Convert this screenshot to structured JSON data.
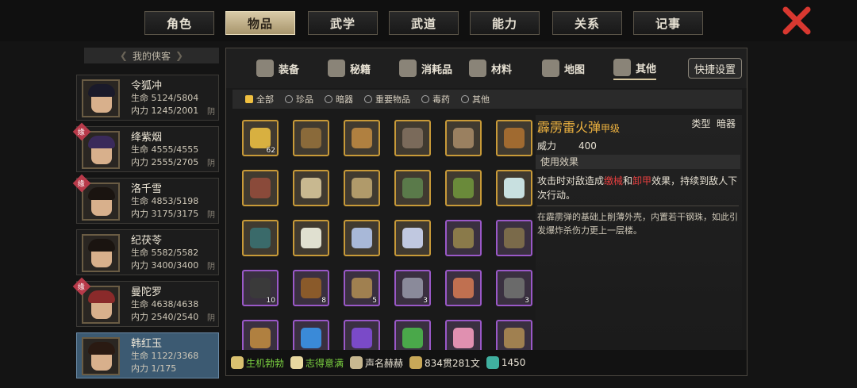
{
  "tabs": [
    "角色",
    "物品",
    "武学",
    "武道",
    "能力",
    "关系",
    "记事"
  ],
  "active_tab": 1,
  "roster": {
    "header": "我的侠客",
    "heroes": [
      {
        "name": "令狐冲",
        "hp_label": "生命",
        "hp": "5124/5804",
        "mp_label": "内力",
        "mp": "1245/2001",
        "suffix": "阴",
        "marked": false,
        "selected": false
      },
      {
        "name": "绛紫烟",
        "hp_label": "生命",
        "hp": "4555/4555",
        "mp_label": "内力",
        "mp": "2555/2705",
        "suffix": "阴",
        "marked": true,
        "selected": false
      },
      {
        "name": "洛千雪",
        "hp_label": "生命",
        "hp": "4853/5198",
        "mp_label": "内力",
        "mp": "3175/3175",
        "suffix": "阴",
        "marked": true,
        "selected": false
      },
      {
        "name": "纪茯苓",
        "hp_label": "生命",
        "hp": "5582/5582",
        "mp_label": "内力",
        "mp": "3400/3400",
        "suffix": "阴",
        "marked": false,
        "selected": false
      },
      {
        "name": "曼陀罗",
        "hp_label": "生命",
        "hp": "4638/4638",
        "mp_label": "内力",
        "mp": "2540/2540",
        "suffix": "阴",
        "marked": true,
        "selected": false
      },
      {
        "name": "韩红玉",
        "hp_label": "生命",
        "hp": "1122/3368",
        "mp_label": "内力",
        "mp": "1/175",
        "suffix": "",
        "marked": false,
        "selected": true
      }
    ],
    "mark_text": "缘"
  },
  "categories": [
    {
      "label": "装备",
      "icon": "equipment-icon"
    },
    {
      "label": "秘籍",
      "icon": "manual-icon"
    },
    {
      "label": "消耗品",
      "icon": "potion-icon"
    },
    {
      "label": "材料",
      "icon": "herb-icon"
    },
    {
      "label": "地图",
      "icon": "map-icon"
    },
    {
      "label": "其他",
      "icon": "other-icon"
    }
  ],
  "active_category": 5,
  "quick_setup": "快捷设置",
  "filters": [
    {
      "label": "全部",
      "on": true
    },
    {
      "label": "珍品",
      "on": false
    },
    {
      "label": "暗器",
      "on": false
    },
    {
      "label": "重要物品",
      "on": false
    },
    {
      "label": "毒药",
      "on": false
    },
    {
      "label": "其他",
      "on": false
    }
  ],
  "items": [
    [
      {
        "q": "gold",
        "count": "62",
        "icon": "gold-ingot-icon",
        "color": "#d8b040"
      },
      {
        "q": "gold",
        "count": "",
        "icon": "pickaxe-icon",
        "color": "#8a6a3a"
      },
      {
        "q": "gold",
        "count": "",
        "icon": "axe-icon",
        "color": "#b08040"
      },
      {
        "q": "gold",
        "count": "",
        "icon": "fishing-rod-icon",
        "color": "#7a6a5a"
      },
      {
        "q": "gold",
        "count": "",
        "icon": "sickle-icon",
        "color": "#9a8060"
      },
      {
        "q": "gold",
        "count": "",
        "icon": "ladle-icon",
        "color": "#a06a30"
      }
    ],
    [
      {
        "q": "gold",
        "count": "",
        "icon": "drum-icon",
        "color": "#8a4a3a"
      },
      {
        "q": "gold",
        "count": "",
        "icon": "scroll-icon",
        "color": "#c8b890"
      },
      {
        "q": "gold",
        "count": "",
        "icon": "map-scroll-icon",
        "color": "#b09a6a"
      },
      {
        "q": "gold",
        "count": "",
        "icon": "jade-figure-icon",
        "color": "#5a7a4a"
      },
      {
        "q": "gold",
        "count": "",
        "icon": "bronze-beast-icon",
        "color": "#6a8a3a"
      },
      {
        "q": "gold",
        "count": "",
        "icon": "pearl-icon",
        "color": "#c8e0e0"
      }
    ],
    [
      {
        "q": "gold",
        "count": "",
        "icon": "jade-box-icon",
        "color": "#3a6a6a"
      },
      {
        "q": "gold",
        "count": "",
        "icon": "bowl-icon",
        "color": "#e0e0d0"
      },
      {
        "q": "gold",
        "count": "",
        "icon": "disc-icon",
        "color": "#a8b8d8"
      },
      {
        "q": "gold",
        "count": "",
        "icon": "plate-icon",
        "color": "#c0c8e0"
      },
      {
        "q": "purple",
        "count": "",
        "icon": "ring-icon",
        "color": "#8a7a4a"
      },
      {
        "q": "purple",
        "count": "",
        "icon": "bangle-icon",
        "color": "#7a6a4a"
      }
    ],
    [
      {
        "q": "purple",
        "count": "10",
        "icon": "iron-balls-icon",
        "color": "#3a3a3a"
      },
      {
        "q": "purple",
        "count": "8",
        "icon": "thunder-bomb-icon",
        "color": "#8a5a2a"
      },
      {
        "q": "purple",
        "count": "5",
        "icon": "needles-icon",
        "color": "#a08050"
      },
      {
        "q": "purple",
        "count": "3",
        "icon": "dart-icon",
        "color": "#8a8a9a"
      },
      {
        "q": "purple",
        "count": "",
        "icon": "talisman-icon",
        "color": "#c07050"
      },
      {
        "q": "purple",
        "count": "3",
        "icon": "token-icon",
        "color": "#6a6a6a"
      }
    ],
    [
      {
        "q": "purple",
        "count": "",
        "icon": "key-icon",
        "color": "#b08040"
      },
      {
        "q": "purple",
        "count": "",
        "icon": "water-orb-icon",
        "color": "#3a8ad8"
      },
      {
        "q": "purple",
        "count": "",
        "icon": "thunder-orb-icon",
        "color": "#7a4ac8"
      },
      {
        "q": "purple",
        "count": "",
        "icon": "wood-orb-icon",
        "color": "#4aa84a"
      },
      {
        "q": "purple",
        "count": "",
        "icon": "flower-icon",
        "color": "#e090b0"
      },
      {
        "q": "purple",
        "count": "",
        "icon": "flute-icon",
        "color": "#a08050"
      }
    ]
  ],
  "detail": {
    "name": "霹雳雷火弹",
    "grade": "甲级",
    "type_label": "类型",
    "type_value": "暗器",
    "power_label": "威力",
    "power_value": "400",
    "effect_header": "使用效果",
    "effect_a": "攻击时对敌造成",
    "effect_red1": "缴械",
    "effect_b": "和",
    "effect_red2": "卸甲",
    "effect_c": "效果，持续到敌人下次行动。",
    "description": "在霹雳弹的基础上削薄外壳，内置若干钢珠，如此引发爆炸杀伤力更上一层楼。"
  },
  "status": [
    {
      "text": "生机勃勃",
      "color": "#7ad040",
      "icon": "vitality-icon",
      "icon_color": "#d8c070"
    },
    {
      "text": "志得意满",
      "color": "#7ad040",
      "icon": "mood-icon",
      "icon_color": "#e8d8a0"
    },
    {
      "text": "声名赫赫",
      "color": "#e8e2d4",
      "icon": "fame-icon",
      "icon_color": "#c8b890"
    },
    {
      "text": "834贯281文",
      "color": "#e8e2d4",
      "icon": "coin-icon",
      "icon_color": "#c8a858"
    },
    {
      "text": "1450",
      "color": "#e8e2d4",
      "icon": "jade-coin-icon",
      "icon_color": "#40b0a0"
    }
  ]
}
